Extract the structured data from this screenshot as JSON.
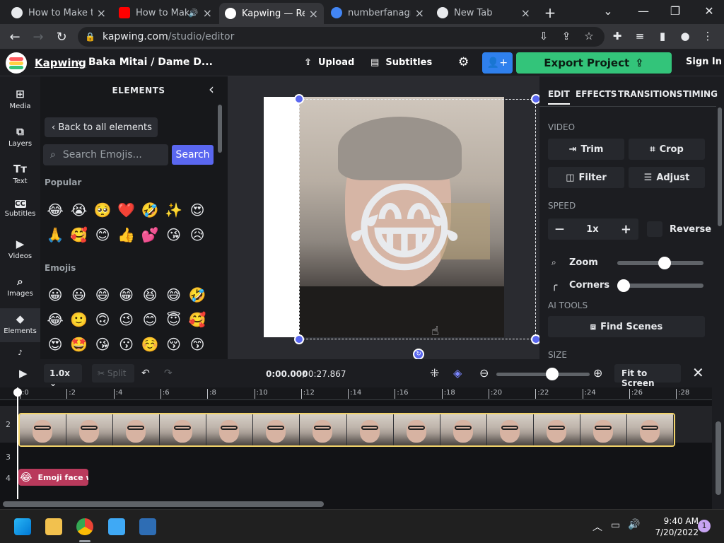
{
  "browser": {
    "tabs": [
      {
        "title": "How to Make th",
        "close": "×",
        "favicon_color": "#e8eaed"
      },
      {
        "title": "How to Mak",
        "close": "×",
        "favicon_color": "#ff0000",
        "audio_icon": "🔊"
      },
      {
        "title": "Kapwing — Rea",
        "close": "×",
        "favicon_color": "#ffffff"
      },
      {
        "title": "numberfanagra",
        "close": "×",
        "favicon_color": "#4285f4"
      },
      {
        "title": "New Tab",
        "close": "×",
        "favicon_color": "#e8eaed"
      }
    ],
    "new_tab": "+",
    "address_host": "kapwing.com",
    "address_path": "/studio/editor",
    "window_controls": [
      "⌄",
      "—",
      "❐",
      "✕"
    ]
  },
  "header": {
    "brand": "Kapwing",
    "crumb_sep": "›",
    "project": "Baka Mitai / Dame D...",
    "upload": "Upload",
    "subtitles": "Subtitles",
    "export": "Export Project",
    "signin": "Sign In"
  },
  "rail": [
    {
      "label": "Media",
      "icon": "⊞"
    },
    {
      "label": "Layers",
      "icon": "⧉"
    },
    {
      "label": "Text",
      "icon": "Tт"
    },
    {
      "label": "Subtitles",
      "icon": "CC"
    },
    {
      "label": "Videos",
      "icon": "▶"
    },
    {
      "label": "Images",
      "icon": "⌕"
    },
    {
      "label": "Elements",
      "icon": "◆"
    }
  ],
  "elements_panel": {
    "title": "ELEMENTS",
    "back": "Back to all elements",
    "search_placeholder": "Search Emojis...",
    "search_button": "Search",
    "popular_label": "Popular",
    "popular": [
      "😂",
      "😭",
      "🥺",
      "❤️",
      "🤣",
      "✨",
      "😍",
      "🙏",
      "🥰",
      "😊",
      "👍",
      "💕",
      "😘",
      "😥"
    ],
    "emojis_label": "Emojis",
    "emojis": [
      "😀",
      "😃",
      "😄",
      "😁",
      "😆",
      "😅",
      "🤣",
      "😂",
      "🙂",
      "🙃",
      "😉",
      "😊",
      "😇",
      "🥰",
      "😍",
      "🤩",
      "😘",
      "😗",
      "☺️",
      "😚",
      "😙"
    ]
  },
  "canvas": {
    "overlay_emoji": "😂"
  },
  "right_panel": {
    "tabs": [
      "EDIT",
      "EFFECTS",
      "TRANSITIONS",
      "TIMING"
    ],
    "video_label": "VIDEO",
    "trim": "Trim",
    "crop": "Crop",
    "filter": "Filter",
    "adjust": "Adjust",
    "speed_label": "SPEED",
    "speed_value": "1x",
    "minus": "—",
    "plus": "+",
    "reverse": "Reverse",
    "zoom": "Zoom",
    "zoom_level": 0.55,
    "corners": "Corners",
    "corners_level": 0.0,
    "ai_label": "AI TOOLS",
    "find_scenes": "Find Scenes",
    "size_label": "SIZE"
  },
  "timeline": {
    "speed": "1.0x",
    "split": "Split",
    "current": "0:00.000",
    "total": "/ 0:27.867",
    "fit": "Fit to Screen",
    "zoom_level": 0.6,
    "ticks": [
      ":0",
      ":2",
      ":4",
      ":6",
      ":8",
      ":10",
      ":12",
      ":14",
      ":16",
      ":18",
      ":20",
      ":22",
      ":24",
      ":26",
      ":28"
    ],
    "rows": [
      "2",
      "3",
      "4"
    ],
    "emoji_clip_label": "Emoji face wi",
    "emoji_clip_icon": "😂"
  },
  "taskbar": {
    "time": "9:40 AM",
    "date": "7/20/2022",
    "notifications": "1"
  }
}
